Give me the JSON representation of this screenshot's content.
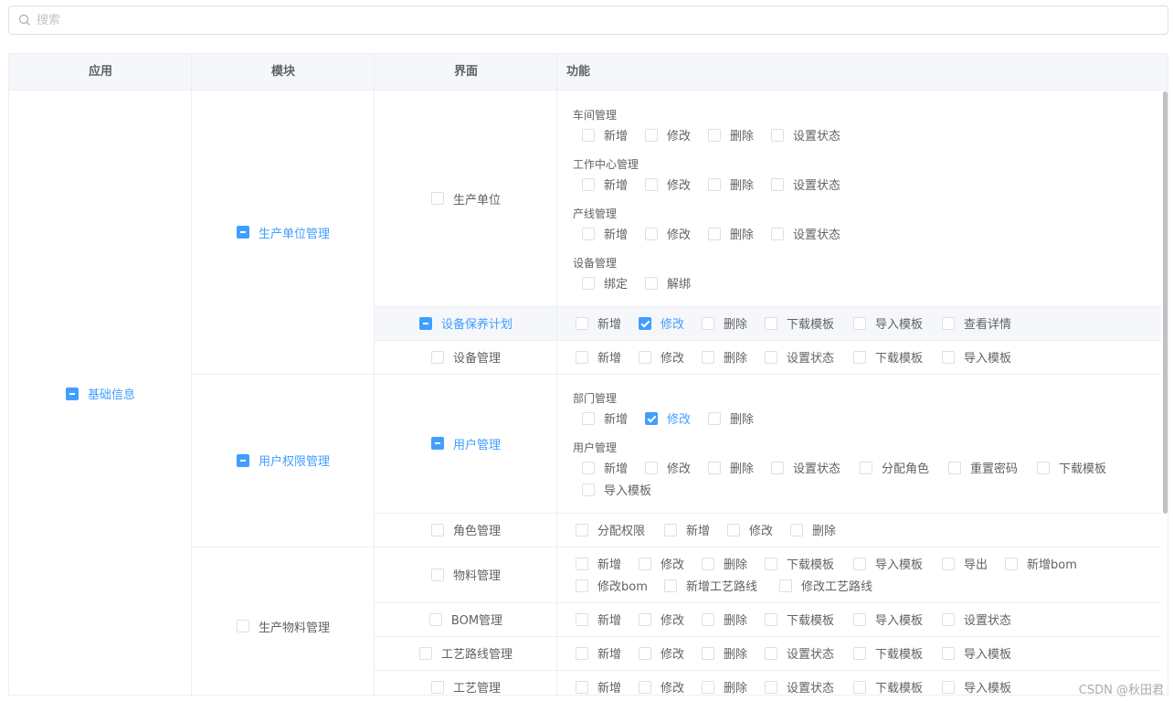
{
  "search": {
    "placeholder": "搜索"
  },
  "headers": {
    "app": "应用",
    "module": "模块",
    "page": "界面",
    "func": "功能"
  },
  "app": {
    "label": "基础信息",
    "state": "ind"
  },
  "modules": [
    {
      "label": "生产单位管理",
      "state": "ind"
    },
    {
      "label": "用户权限管理",
      "state": "ind"
    },
    {
      "label": "生产物料管理",
      "state": "off"
    }
  ],
  "pages": [
    {
      "label": "生产单位",
      "state": "off"
    },
    {
      "label": "设备保养计划",
      "state": "ind"
    },
    {
      "label": "设备管理",
      "state": "off"
    },
    {
      "label": "用户管理",
      "state": "ind"
    },
    {
      "label": "角色管理",
      "state": "off"
    },
    {
      "label": "物料管理",
      "state": "off"
    },
    {
      "label": "BOM管理",
      "state": "off"
    },
    {
      "label": "工艺路线管理",
      "state": "off"
    },
    {
      "label": "工艺管理",
      "state": "off"
    }
  ],
  "groups": [
    "车间管理",
    "工作中心管理",
    "产线管理",
    "设备管理",
    "部门管理",
    "用户管理"
  ],
  "funcs": [
    {
      "label": "新增",
      "state": "off"
    },
    {
      "label": "修改",
      "state": "off"
    },
    {
      "label": "删除",
      "state": "off"
    },
    {
      "label": "设置状态",
      "state": "off"
    },
    {
      "label": "新增",
      "state": "off"
    },
    {
      "label": "修改",
      "state": "off"
    },
    {
      "label": "删除",
      "state": "off"
    },
    {
      "label": "设置状态",
      "state": "off"
    },
    {
      "label": "新增",
      "state": "off"
    },
    {
      "label": "修改",
      "state": "off"
    },
    {
      "label": "删除",
      "state": "off"
    },
    {
      "label": "设置状态",
      "state": "off"
    },
    {
      "label": "绑定",
      "state": "off"
    },
    {
      "label": "解绑",
      "state": "off"
    },
    {
      "label": "新增",
      "state": "off"
    },
    {
      "label": "修改",
      "state": "on"
    },
    {
      "label": "删除",
      "state": "off"
    },
    {
      "label": "下载模板",
      "state": "off"
    },
    {
      "label": "导入模板",
      "state": "off"
    },
    {
      "label": "查看详情",
      "state": "off"
    },
    {
      "label": "新增",
      "state": "off"
    },
    {
      "label": "修改",
      "state": "off"
    },
    {
      "label": "删除",
      "state": "off"
    },
    {
      "label": "设置状态",
      "state": "off"
    },
    {
      "label": "下载模板",
      "state": "off"
    },
    {
      "label": "导入模板",
      "state": "off"
    },
    {
      "label": "新增",
      "state": "off"
    },
    {
      "label": "修改",
      "state": "on"
    },
    {
      "label": "删除",
      "state": "off"
    },
    {
      "label": "新增",
      "state": "off"
    },
    {
      "label": "修改",
      "state": "off"
    },
    {
      "label": "删除",
      "state": "off"
    },
    {
      "label": "设置状态",
      "state": "off"
    },
    {
      "label": "分配角色",
      "state": "off"
    },
    {
      "label": "重置密码",
      "state": "off"
    },
    {
      "label": "下载模板",
      "state": "off"
    },
    {
      "label": "导入模板",
      "state": "off"
    },
    {
      "label": "分配权限",
      "state": "off"
    },
    {
      "label": "新增",
      "state": "off"
    },
    {
      "label": "修改",
      "state": "off"
    },
    {
      "label": "删除",
      "state": "off"
    },
    {
      "label": "新增",
      "state": "off"
    },
    {
      "label": "修改",
      "state": "off"
    },
    {
      "label": "删除",
      "state": "off"
    },
    {
      "label": "下载模板",
      "state": "off"
    },
    {
      "label": "导入模板",
      "state": "off"
    },
    {
      "label": "导出",
      "state": "off"
    },
    {
      "label": "新增bom",
      "state": "off"
    },
    {
      "label": "修改bom",
      "state": "off"
    },
    {
      "label": "新增工艺路线",
      "state": "off"
    },
    {
      "label": "修改工艺路线",
      "state": "off"
    },
    {
      "label": "新增",
      "state": "off"
    },
    {
      "label": "修改",
      "state": "off"
    },
    {
      "label": "删除",
      "state": "off"
    },
    {
      "label": "下载模板",
      "state": "off"
    },
    {
      "label": "导入模板",
      "state": "off"
    },
    {
      "label": "设置状态",
      "state": "off"
    },
    {
      "label": "新增",
      "state": "off"
    },
    {
      "label": "修改",
      "state": "off"
    },
    {
      "label": "删除",
      "state": "off"
    },
    {
      "label": "设置状态",
      "state": "off"
    },
    {
      "label": "下载模板",
      "state": "off"
    },
    {
      "label": "导入模板",
      "state": "off"
    },
    {
      "label": "新增",
      "state": "off"
    },
    {
      "label": "修改",
      "state": "off"
    },
    {
      "label": "删除",
      "state": "off"
    },
    {
      "label": "设置状态",
      "state": "off"
    },
    {
      "label": "下载模板",
      "state": "off"
    },
    {
      "label": "导入模板",
      "state": "off"
    }
  ],
  "watermark": "CSDN @秋田君",
  "colors": {
    "accent": "#409eff",
    "border": "#ebeef5",
    "header_bg": "#f5f7fa"
  }
}
